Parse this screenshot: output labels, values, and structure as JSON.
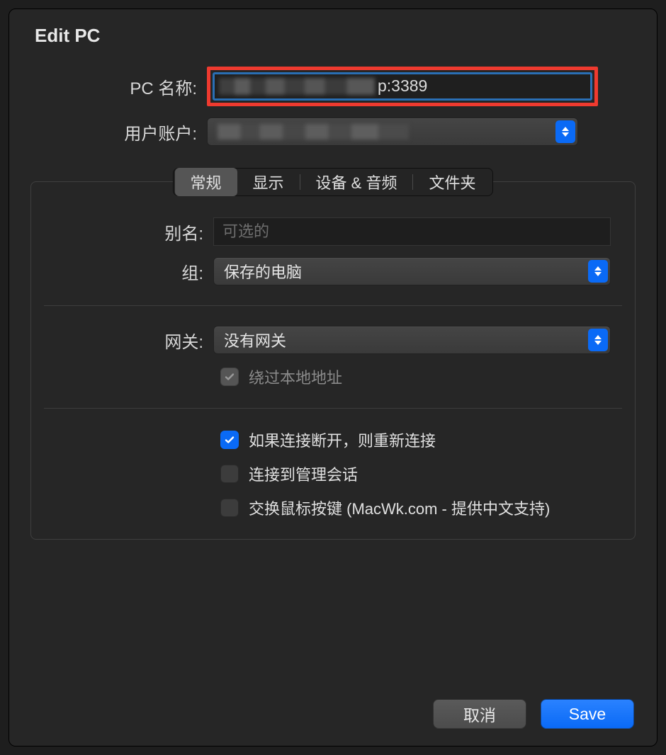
{
  "title": "Edit PC",
  "fields": {
    "pc_name_label": "PC 名称:",
    "pc_name_visible_value": "p:3389",
    "user_account_label": "用户账户:"
  },
  "tabs": {
    "general": "常规",
    "display": "显示",
    "devices_audio": "设备 & 音频",
    "folders": "文件夹"
  },
  "general": {
    "alias_label": "别名:",
    "alias_placeholder": "可选的",
    "group_label": "组:",
    "group_value": "保存的电脑",
    "gateway_label": "网关:",
    "gateway_value": "没有网关",
    "bypass_local_label": "绕过本地地址",
    "reconnect_label": "如果连接断开，则重新连接",
    "admin_session_label": "连接到管理会话",
    "swap_mouse_label": "交换鼠标按键 (MacWk.com - 提供中文支持)"
  },
  "buttons": {
    "cancel": "取消",
    "save": "Save"
  }
}
